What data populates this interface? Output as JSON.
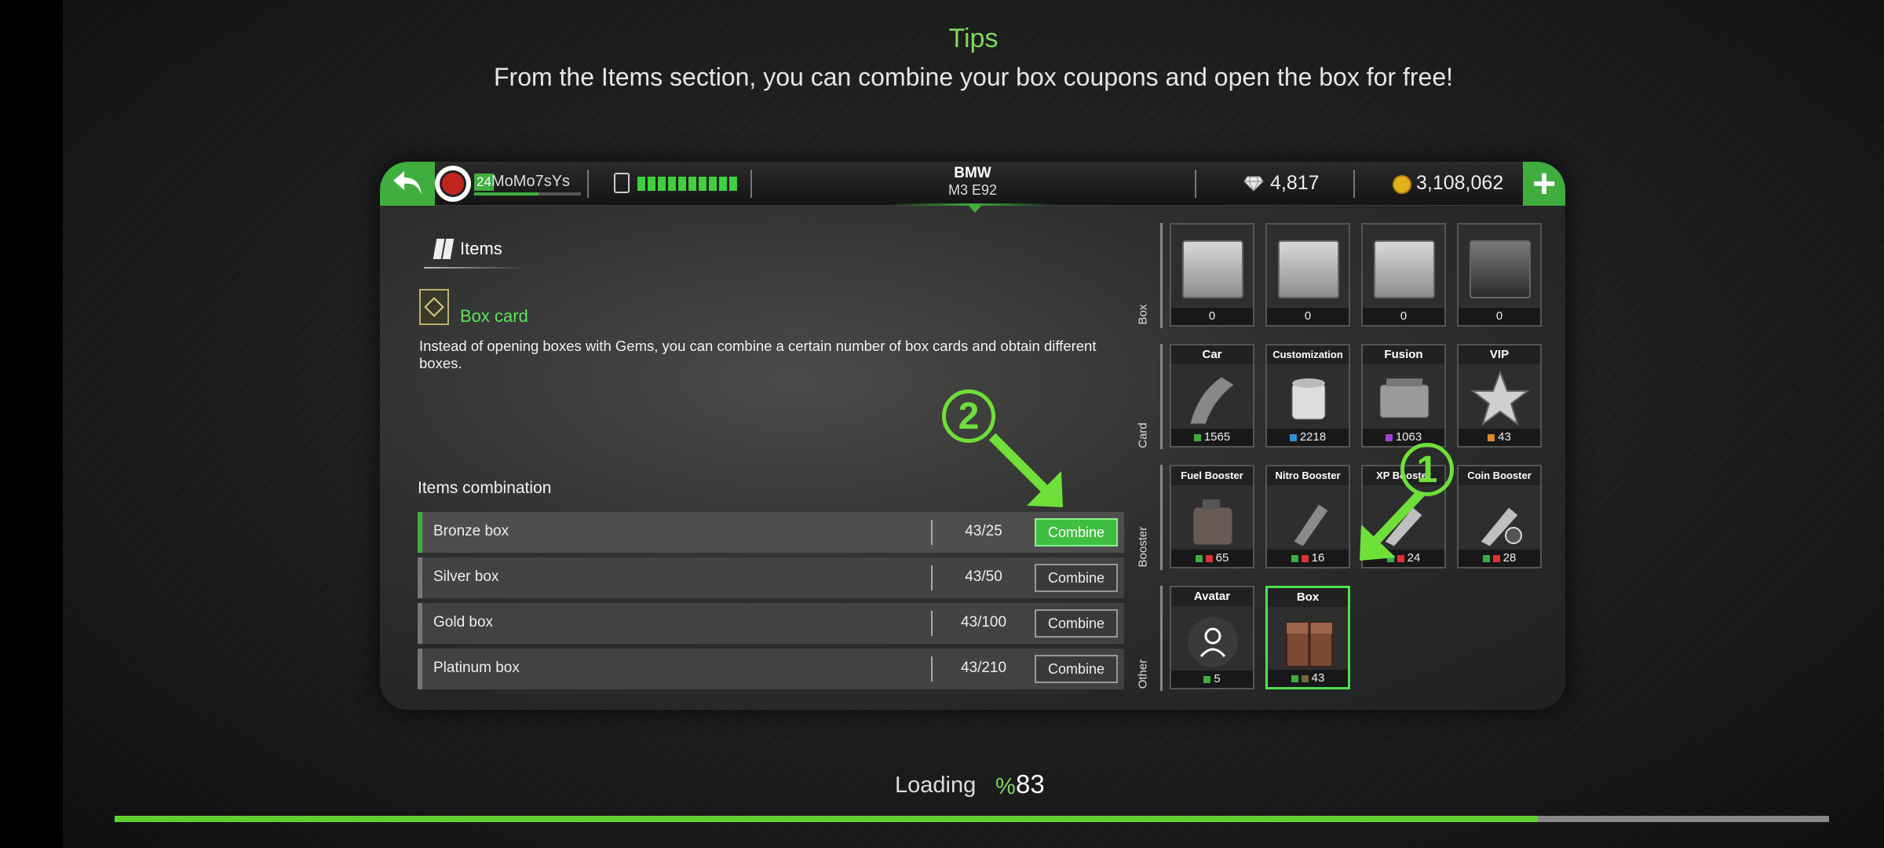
{
  "tips": {
    "title": "Tips",
    "text": "From the Items section, you can combine your box coupons and open the box for free!"
  },
  "topbar": {
    "player_level": "24",
    "player_name": "MoMo7sYs",
    "car_brand": "BMW",
    "car_model": "M3 E92",
    "gems": "4,817",
    "coins": "3,108,062",
    "fuel_segments": 10
  },
  "items_panel": {
    "header": "Items",
    "selected_title": "Box card",
    "description": "Instead of opening boxes with Gems, you can combine a certain number of box cards and obtain different boxes.",
    "combination_title": "Items combination",
    "combinations": [
      {
        "name": "Bronze box",
        "count": "43/25",
        "button": "Combine",
        "active": true
      },
      {
        "name": "Silver box",
        "count": "43/50",
        "button": "Combine",
        "active": false
      },
      {
        "name": "Gold box",
        "count": "43/100",
        "button": "Combine",
        "active": false
      },
      {
        "name": "Platinum box",
        "count": "43/210",
        "button": "Combine",
        "active": false
      }
    ]
  },
  "grid": {
    "row_labels": [
      "Box",
      "Card",
      "Booster",
      "Other"
    ],
    "box_row": [
      {
        "count": "0"
      },
      {
        "count": "0"
      },
      {
        "count": "0"
      },
      {
        "count": "0"
      }
    ],
    "card_row": [
      {
        "label": "Car",
        "count": "1565"
      },
      {
        "label": "Customization",
        "count": "2218"
      },
      {
        "label": "Fusion",
        "count": "1063"
      },
      {
        "label": "VIP",
        "count": "43"
      }
    ],
    "booster_row": [
      {
        "label": "Fuel Booster",
        "count": "65"
      },
      {
        "label": "Nitro Booster",
        "count": "16"
      },
      {
        "label": "XP Booster",
        "count": "24"
      },
      {
        "label": "Coin Booster",
        "count": "28"
      }
    ],
    "other_row": [
      {
        "label": "Avatar",
        "count": "5"
      },
      {
        "label": "Box",
        "count": "43"
      }
    ]
  },
  "annotations": {
    "step1": "1",
    "step2": "2"
  },
  "loading": {
    "label": "Loading",
    "percent_symbol": "%",
    "percent": "83",
    "progress": 0.83
  },
  "colors": {
    "accent": "#3fae3f",
    "annotation": "#6fe03a",
    "progress": "#5fd12f"
  }
}
